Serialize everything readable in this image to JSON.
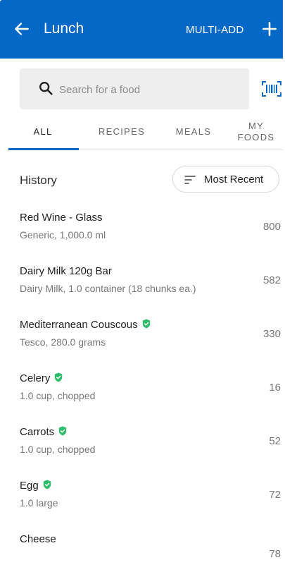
{
  "header": {
    "title": "Lunch",
    "multi_add_label": "MULTI-ADD"
  },
  "search": {
    "placeholder": "Search for a food"
  },
  "tabs": [
    {
      "label": "ALL",
      "active": true
    },
    {
      "label": "RECIPES",
      "active": false
    },
    {
      "label": "MEALS",
      "active": false
    },
    {
      "label": "MY FOODS",
      "active": false
    }
  ],
  "history": {
    "label": "History",
    "sort_label": "Most Recent"
  },
  "foods": [
    {
      "name": "Red Wine - Glass",
      "desc": "Generic, 1,000.0 ml",
      "calories": "800",
      "verified": false
    },
    {
      "name": "Dairy Milk 120g Bar",
      "desc": "Dairy Milk, 1.0 container (18 chunks ea.)",
      "calories": "582",
      "verified": false
    },
    {
      "name": "Mediterranean Couscous",
      "desc": "Tesco, 280.0 grams",
      "calories": "330",
      "verified": true
    },
    {
      "name": "Celery",
      "desc": "1.0 cup, chopped",
      "calories": "16",
      "verified": true
    },
    {
      "name": "Carrots",
      "desc": "1.0 cup, chopped",
      "calories": "52",
      "verified": true
    },
    {
      "name": "Egg",
      "desc": "1.0 large",
      "calories": "72",
      "verified": true
    },
    {
      "name": "Cheese",
      "desc": "",
      "calories": "78",
      "verified": false
    }
  ],
  "icons": {
    "back": "arrow-left-icon",
    "add": "plus-icon",
    "search": "search-icon",
    "barcode": "barcode-scan-icon",
    "sort": "sort-icon",
    "verified": "verified-shield-icon"
  },
  "colors": {
    "primary": "#0568c7",
    "verified": "#2ebd6b"
  }
}
